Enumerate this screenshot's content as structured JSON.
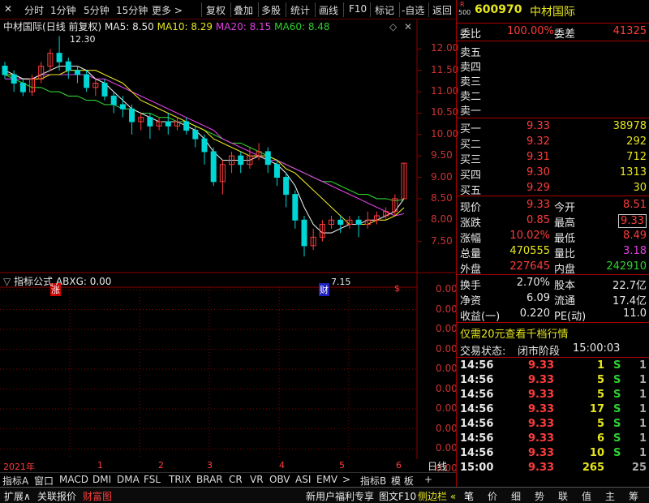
{
  "toolbar": {
    "items": [
      "分时",
      "1分钟",
      "5分钟",
      "15分钟",
      "更多 >",
      "复权",
      "叠加",
      "多股",
      "统计",
      "画线",
      "F10",
      "标记",
      "-自选",
      "返回"
    ]
  },
  "chart_title": {
    "name": "中材国际",
    "period": "(日线 前复权)",
    "ma5": "MA5: 8.50",
    "ma10": "MA10: 8.29",
    "ma20": "MA20: 8.15",
    "ma60": "MA60: 8.48"
  },
  "price_axis": [
    "12.00",
    "11.50",
    "11.00",
    "10.50",
    "10.00",
    "9.50",
    "9.00",
    "8.50",
    "8.00",
    "7.50"
  ],
  "annotations": {
    "high": "12.30",
    "low": "7.15",
    "zhang": "涨",
    "cai": "财",
    "dollar": "$"
  },
  "indicator": {
    "label": "指标公式",
    "value": "ABXG: 0.00",
    "axis": [
      "0.00",
      "0.00",
      "0.00",
      "0.00",
      "0.00",
      "0.00",
      "0.00",
      "0.00",
      "0.00",
      "0.00"
    ]
  },
  "dates": {
    "year": "2021年",
    "months": [
      "1",
      "2",
      "3",
      "4",
      "5",
      "6"
    ],
    "period_btn": "日线"
  },
  "tabs": [
    "指标A",
    "窗口",
    "MACD",
    "DMI",
    "DMA",
    "FSL",
    "TRIX",
    "BRAR",
    "CR",
    "VR",
    "OBV",
    "ASI",
    "EMV",
    ">",
    "指标B",
    "模 板",
    "+"
  ],
  "bottom": {
    "left": [
      "扩展∧",
      "关联报价",
      "财富图"
    ],
    "mid": [
      "新用户福利专享",
      "图文F10",
      "侧边栏 «"
    ],
    "right": [
      "笔",
      "价",
      "细",
      "势",
      "联",
      "值",
      "主",
      "筹"
    ]
  },
  "quote": {
    "code": "600970",
    "name": "中材国际",
    "r_label": "R",
    "r_num": "500",
    "wei_bi_label": "委比",
    "wei_bi": "100.00%",
    "wei_cha_label": "委差",
    "wei_cha": "41325",
    "sell": [
      {
        "label": "卖五",
        "price": "",
        "vol": ""
      },
      {
        "label": "卖四",
        "price": "",
        "vol": ""
      },
      {
        "label": "卖三",
        "price": "",
        "vol": ""
      },
      {
        "label": "卖二",
        "price": "",
        "vol": ""
      },
      {
        "label": "卖一",
        "price": "",
        "vol": ""
      }
    ],
    "buy": [
      {
        "label": "买一",
        "price": "9.33",
        "vol": "38978"
      },
      {
        "label": "买二",
        "price": "9.32",
        "vol": "292"
      },
      {
        "label": "买三",
        "price": "9.31",
        "vol": "712"
      },
      {
        "label": "买四",
        "price": "9.30",
        "vol": "1313"
      },
      {
        "label": "买五",
        "price": "9.29",
        "vol": "30"
      }
    ],
    "stats": [
      {
        "l1": "现价",
        "v1": "9.33",
        "l2": "今开",
        "v2": "8.51"
      },
      {
        "l1": "涨跌",
        "v1": "0.85",
        "l2": "最高",
        "v2": "9.33"
      },
      {
        "l1": "涨幅",
        "v1": "10.02%",
        "l2": "最低",
        "v2": "8.49"
      },
      {
        "l1": "总量",
        "v1": "470555",
        "l2": "量比",
        "v2": "3.18"
      },
      {
        "l1": "外盘",
        "v1": "227645",
        "l2": "内盘",
        "v2": "242910"
      }
    ],
    "fund": [
      {
        "l1": "换手",
        "v1": "2.70%",
        "l2": "股本",
        "v2": "22.7亿"
      },
      {
        "l1": "净资",
        "v1": "6.09",
        "l2": "流通",
        "v2": "17.4亿"
      },
      {
        "l1": "收益(一)",
        "v1": "0.220",
        "l2": "PE(动)",
        "v2": "11.0"
      }
    ],
    "promo": "仅需20元查看千档行情",
    "status_label": "交易状态:",
    "status_value": "闭市阶段",
    "status_time": "15:00:03",
    "ticks": [
      {
        "t": "14:56",
        "p": "9.33",
        "v": "1",
        "s": "S",
        "n": "1"
      },
      {
        "t": "14:56",
        "p": "9.33",
        "v": "5",
        "s": "S",
        "n": "1"
      },
      {
        "t": "14:56",
        "p": "9.33",
        "v": "5",
        "s": "S",
        "n": "1"
      },
      {
        "t": "14:56",
        "p": "9.33",
        "v": "17",
        "s": "S",
        "n": "1"
      },
      {
        "t": "14:56",
        "p": "9.33",
        "v": "5",
        "s": "S",
        "n": "1"
      },
      {
        "t": "14:56",
        "p": "9.33",
        "v": "6",
        "s": "S",
        "n": "1"
      },
      {
        "t": "14:56",
        "p": "9.33",
        "v": "10",
        "s": "S",
        "n": "1"
      },
      {
        "t": "15:00",
        "p": "9.33",
        "v": "265",
        "s": "",
        "n": "25"
      }
    ]
  },
  "chart_data": {
    "type": "line",
    "ylim": [
      7.0,
      12.5
    ],
    "candles": [
      [
        11.6,
        11.4,
        11.7,
        11.3
      ],
      [
        11.4,
        11.2,
        11.5,
        11.0
      ],
      [
        11.2,
        11.0,
        11.3,
        10.9
      ],
      [
        11.0,
        11.3,
        11.4,
        10.9
      ],
      [
        11.3,
        11.6,
        11.7,
        11.2
      ],
      [
        11.6,
        11.9,
        12.0,
        11.5
      ],
      [
        11.9,
        11.7,
        12.3,
        11.5
      ],
      [
        11.7,
        11.5,
        11.8,
        11.3
      ],
      [
        11.5,
        11.4,
        11.6,
        11.2
      ],
      [
        11.4,
        11.1,
        11.5,
        11.0
      ],
      [
        11.1,
        11.2,
        11.3,
        10.9
      ],
      [
        11.2,
        10.9,
        11.3,
        10.8
      ],
      [
        10.9,
        10.7,
        11.0,
        10.5
      ],
      [
        10.7,
        10.6,
        10.9,
        10.4
      ],
      [
        10.6,
        10.3,
        10.7,
        10.0
      ],
      [
        10.3,
        10.4,
        10.5,
        10.1
      ],
      [
        10.4,
        10.2,
        10.5,
        9.9
      ],
      [
        10.2,
        10.3,
        10.4,
        10.1
      ],
      [
        10.3,
        10.2,
        10.5,
        10.0
      ],
      [
        10.2,
        10.3,
        10.4,
        10.1
      ],
      [
        10.3,
        10.1,
        10.4,
        10.0
      ],
      [
        10.1,
        9.9,
        10.2,
        9.7
      ],
      [
        9.9,
        9.6,
        10.0,
        9.3
      ],
      [
        9.6,
        8.9,
        9.7,
        8.8
      ],
      [
        8.9,
        9.3,
        9.4,
        8.6
      ],
      [
        9.3,
        9.5,
        9.6,
        9.1
      ],
      [
        9.5,
        9.3,
        9.6,
        9.1
      ],
      [
        9.3,
        9.5,
        9.7,
        9.2
      ],
      [
        9.5,
        9.6,
        9.8,
        9.4
      ],
      [
        9.6,
        9.3,
        9.7,
        9.1
      ],
      [
        9.3,
        9.0,
        9.4,
        8.8
      ],
      [
        9.0,
        8.6,
        9.1,
        8.3
      ],
      [
        8.6,
        8.0,
        8.7,
        7.8
      ],
      [
        8.0,
        7.4,
        8.1,
        7.15
      ],
      [
        7.4,
        7.6,
        7.8,
        7.3
      ],
      [
        7.6,
        7.9,
        8.0,
        7.5
      ],
      [
        7.9,
        8.0,
        8.1,
        7.8
      ],
      [
        8.0,
        7.9,
        8.1,
        7.7
      ],
      [
        7.9,
        8.0,
        8.1,
        7.8
      ],
      [
        8.0,
        7.9,
        8.1,
        7.6
      ],
      [
        7.9,
        8.0,
        8.2,
        7.8
      ],
      [
        8.0,
        8.1,
        8.2,
        7.9
      ],
      [
        8.1,
        8.2,
        8.3,
        8.0
      ],
      [
        8.2,
        8.5,
        8.6,
        8.1
      ],
      [
        8.5,
        9.33,
        9.33,
        8.49
      ]
    ],
    "ma5": [
      11.5,
      11.4,
      11.3,
      11.3,
      11.4,
      11.5,
      11.6,
      11.6,
      11.6,
      11.5,
      11.3,
      11.2,
      11.0,
      10.8,
      10.6,
      10.5,
      10.4,
      10.3,
      10.3,
      10.3,
      10.2,
      10.1,
      9.9,
      9.6,
      9.4,
      9.4,
      9.4,
      9.4,
      9.5,
      9.4,
      9.3,
      9.1,
      8.8,
      8.3,
      7.9,
      7.7,
      7.7,
      7.8,
      7.9,
      7.9,
      8.0,
      8.0,
      8.1,
      8.2,
      8.5
    ],
    "ma10": [
      11.4,
      11.4,
      11.3,
      11.3,
      11.3,
      11.4,
      11.4,
      11.5,
      11.5,
      11.5,
      11.5,
      11.4,
      11.3,
      11.2,
      11.0,
      10.8,
      10.7,
      10.6,
      10.5,
      10.4,
      10.3,
      10.2,
      10.1,
      9.9,
      9.8,
      9.7,
      9.6,
      9.5,
      9.5,
      9.5,
      9.4,
      9.2,
      9.1,
      8.9,
      8.7,
      8.5,
      8.3,
      8.1,
      7.9,
      7.9,
      7.9,
      8.0,
      8.0,
      8.1,
      8.29
    ],
    "ma20": [
      11.3,
      11.3,
      11.3,
      11.3,
      11.4,
      11.4,
      11.4,
      11.4,
      11.4,
      11.4,
      11.3,
      11.3,
      11.2,
      11.1,
      11.0,
      10.9,
      10.8,
      10.7,
      10.6,
      10.5,
      10.4,
      10.3,
      10.2,
      10.1,
      9.9,
      9.8,
      9.7,
      9.6,
      9.5,
      9.4,
      9.4,
      9.3,
      9.2,
      9.1,
      9.0,
      8.9,
      8.8,
      8.7,
      8.6,
      8.5,
      8.4,
      8.3,
      8.2,
      8.1,
      8.15
    ],
    "ma60": [
      11.4,
      11.3,
      11.2,
      11.1,
      11.1,
      11.0,
      11.0,
      10.9,
      10.9,
      10.8,
      10.8,
      10.7,
      10.7,
      10.6,
      10.6,
      10.5,
      10.5,
      10.4,
      10.4,
      10.3,
      10.3,
      10.2,
      10.1,
      10.0,
      9.9,
      9.8,
      9.8,
      9.7,
      9.6,
      9.5,
      9.4,
      9.3,
      9.2,
      9.1,
      9.0,
      8.9,
      8.9,
      8.8,
      8.7,
      8.6,
      8.6,
      8.5,
      8.5,
      8.45,
      8.48
    ]
  },
  "colors": {
    "up": "#ff3c3c",
    "down": "#00d6d6",
    "ma5": "#e8e8e8",
    "ma10": "#e6e61e",
    "ma20": "#e040e0",
    "ma60": "#2fd02f",
    "grid": "#8b0000"
  }
}
